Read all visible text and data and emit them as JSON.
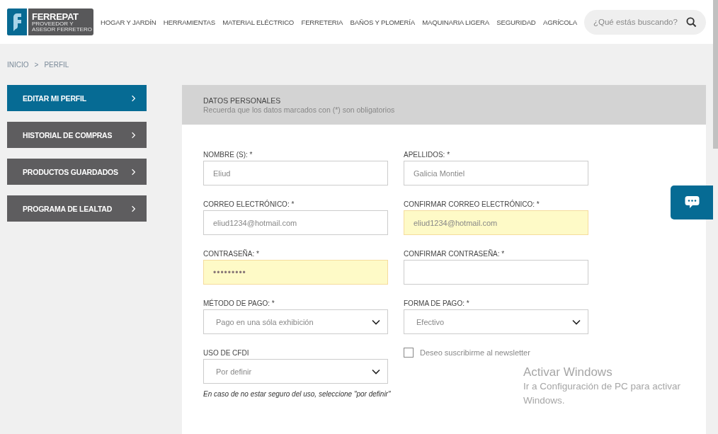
{
  "logo": {
    "name": "FERREPAT",
    "tagline": "PROVEEDOR Y ASESOR FERRETERO"
  },
  "nav": {
    "items": [
      "HOGAR Y JARDÍN",
      "HERRAMIENTAS",
      "MATERIAL ELÉCTRICO",
      "FERRETERIA",
      "BAÑOS Y PLOMERÍA",
      "MAQUINARIA LIGERA",
      "SEGURIDAD",
      "AGRÍCOLA"
    ]
  },
  "search": {
    "placeholder": "¿Qué estás buscando?"
  },
  "breadcrumb": {
    "items": [
      "INICIO",
      "PERFIL"
    ],
    "separator": ">"
  },
  "sidebar": {
    "items": [
      {
        "label": "EDITAR MI PERFIL",
        "selected": true
      },
      {
        "label": "HISTORIAL DE COMPRAS",
        "selected": false
      },
      {
        "label": "PRODUCTOS GUARDADOS",
        "selected": false
      },
      {
        "label": "PROGRAMA DE LEALTAD",
        "selected": false
      }
    ]
  },
  "form": {
    "title": "DATOS PERSONALES",
    "subtitle": "Recuerda que los datos marcados con (*) son obligatorios",
    "fields": [
      {
        "kind": "text",
        "label": "NOMBRE (S): *",
        "value": "Eliud",
        "autofilled": false
      },
      {
        "kind": "text",
        "label": "APELLIDOS: *",
        "value": "Galicia Montiel",
        "autofilled": false
      },
      {
        "kind": "text",
        "label": "CORREO ELECTRÓNICO: *",
        "value": "eliud1234@hotmail.com",
        "autofilled": false
      },
      {
        "kind": "text",
        "label": "CONFIRMAR CORREO ELECTRÓNICO: *",
        "value": "eliud1234@hotmail.com",
        "autofilled": true
      },
      {
        "kind": "password",
        "label": "CONTRASEÑA: *",
        "value": "•••••••••",
        "autofilled": true
      },
      {
        "kind": "password",
        "label": "CONFIRMAR CONTRASEÑA: *",
        "autofilled": false
      },
      {
        "kind": "select",
        "label": "MÉTODO DE PAGO: *",
        "value": "Pago en una sóla exhibición"
      },
      {
        "kind": "select",
        "label": "FORMA DE PAGO: *",
        "value": "Efectivo"
      },
      {
        "kind": "select",
        "label": "USO DE CFDI",
        "value": "Por definir",
        "note": "En caso de no estar seguro del uso, seleccione \"por definir\""
      },
      {
        "kind": "checkbox",
        "label": "Deseo suscribirme al newsletter",
        "checked": false
      }
    ]
  },
  "os_notice": {
    "title": "Activar Windows",
    "text": "Ir a Configuración de PC para activar Windows."
  }
}
